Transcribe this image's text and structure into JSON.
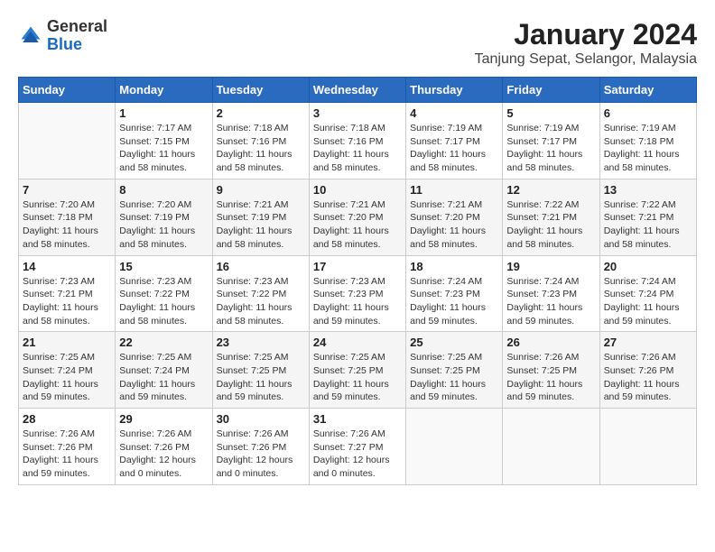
{
  "header": {
    "logo_line1": "General",
    "logo_line2": "Blue",
    "title": "January 2024",
    "subtitle": "Tanjung Sepat, Selangor, Malaysia"
  },
  "calendar": {
    "days_of_week": [
      "Sunday",
      "Monday",
      "Tuesday",
      "Wednesday",
      "Thursday",
      "Friday",
      "Saturday"
    ],
    "weeks": [
      [
        {
          "day": "",
          "sunrise": "",
          "sunset": "",
          "daylight": ""
        },
        {
          "day": "1",
          "sunrise": "Sunrise: 7:17 AM",
          "sunset": "Sunset: 7:15 PM",
          "daylight": "Daylight: 11 hours and 58 minutes."
        },
        {
          "day": "2",
          "sunrise": "Sunrise: 7:18 AM",
          "sunset": "Sunset: 7:16 PM",
          "daylight": "Daylight: 11 hours and 58 minutes."
        },
        {
          "day": "3",
          "sunrise": "Sunrise: 7:18 AM",
          "sunset": "Sunset: 7:16 PM",
          "daylight": "Daylight: 11 hours and 58 minutes."
        },
        {
          "day": "4",
          "sunrise": "Sunrise: 7:19 AM",
          "sunset": "Sunset: 7:17 PM",
          "daylight": "Daylight: 11 hours and 58 minutes."
        },
        {
          "day": "5",
          "sunrise": "Sunrise: 7:19 AM",
          "sunset": "Sunset: 7:17 PM",
          "daylight": "Daylight: 11 hours and 58 minutes."
        },
        {
          "day": "6",
          "sunrise": "Sunrise: 7:19 AM",
          "sunset": "Sunset: 7:18 PM",
          "daylight": "Daylight: 11 hours and 58 minutes."
        }
      ],
      [
        {
          "day": "7",
          "sunrise": "Sunrise: 7:20 AM",
          "sunset": "Sunset: 7:18 PM",
          "daylight": "Daylight: 11 hours and 58 minutes."
        },
        {
          "day": "8",
          "sunrise": "Sunrise: 7:20 AM",
          "sunset": "Sunset: 7:19 PM",
          "daylight": "Daylight: 11 hours and 58 minutes."
        },
        {
          "day": "9",
          "sunrise": "Sunrise: 7:21 AM",
          "sunset": "Sunset: 7:19 PM",
          "daylight": "Daylight: 11 hours and 58 minutes."
        },
        {
          "day": "10",
          "sunrise": "Sunrise: 7:21 AM",
          "sunset": "Sunset: 7:20 PM",
          "daylight": "Daylight: 11 hours and 58 minutes."
        },
        {
          "day": "11",
          "sunrise": "Sunrise: 7:21 AM",
          "sunset": "Sunset: 7:20 PM",
          "daylight": "Daylight: 11 hours and 58 minutes."
        },
        {
          "day": "12",
          "sunrise": "Sunrise: 7:22 AM",
          "sunset": "Sunset: 7:21 PM",
          "daylight": "Daylight: 11 hours and 58 minutes."
        },
        {
          "day": "13",
          "sunrise": "Sunrise: 7:22 AM",
          "sunset": "Sunset: 7:21 PM",
          "daylight": "Daylight: 11 hours and 58 minutes."
        }
      ],
      [
        {
          "day": "14",
          "sunrise": "Sunrise: 7:23 AM",
          "sunset": "Sunset: 7:21 PM",
          "daylight": "Daylight: 11 hours and 58 minutes."
        },
        {
          "day": "15",
          "sunrise": "Sunrise: 7:23 AM",
          "sunset": "Sunset: 7:22 PM",
          "daylight": "Daylight: 11 hours and 58 minutes."
        },
        {
          "day": "16",
          "sunrise": "Sunrise: 7:23 AM",
          "sunset": "Sunset: 7:22 PM",
          "daylight": "Daylight: 11 hours and 58 minutes."
        },
        {
          "day": "17",
          "sunrise": "Sunrise: 7:23 AM",
          "sunset": "Sunset: 7:23 PM",
          "daylight": "Daylight: 11 hours and 59 minutes."
        },
        {
          "day": "18",
          "sunrise": "Sunrise: 7:24 AM",
          "sunset": "Sunset: 7:23 PM",
          "daylight": "Daylight: 11 hours and 59 minutes."
        },
        {
          "day": "19",
          "sunrise": "Sunrise: 7:24 AM",
          "sunset": "Sunset: 7:23 PM",
          "daylight": "Daylight: 11 hours and 59 minutes."
        },
        {
          "day": "20",
          "sunrise": "Sunrise: 7:24 AM",
          "sunset": "Sunset: 7:24 PM",
          "daylight": "Daylight: 11 hours and 59 minutes."
        }
      ],
      [
        {
          "day": "21",
          "sunrise": "Sunrise: 7:25 AM",
          "sunset": "Sunset: 7:24 PM",
          "daylight": "Daylight: 11 hours and 59 minutes."
        },
        {
          "day": "22",
          "sunrise": "Sunrise: 7:25 AM",
          "sunset": "Sunset: 7:24 PM",
          "daylight": "Daylight: 11 hours and 59 minutes."
        },
        {
          "day": "23",
          "sunrise": "Sunrise: 7:25 AM",
          "sunset": "Sunset: 7:25 PM",
          "daylight": "Daylight: 11 hours and 59 minutes."
        },
        {
          "day": "24",
          "sunrise": "Sunrise: 7:25 AM",
          "sunset": "Sunset: 7:25 PM",
          "daylight": "Daylight: 11 hours and 59 minutes."
        },
        {
          "day": "25",
          "sunrise": "Sunrise: 7:25 AM",
          "sunset": "Sunset: 7:25 PM",
          "daylight": "Daylight: 11 hours and 59 minutes."
        },
        {
          "day": "26",
          "sunrise": "Sunrise: 7:26 AM",
          "sunset": "Sunset: 7:25 PM",
          "daylight": "Daylight: 11 hours and 59 minutes."
        },
        {
          "day": "27",
          "sunrise": "Sunrise: 7:26 AM",
          "sunset": "Sunset: 7:26 PM",
          "daylight": "Daylight: 11 hours and 59 minutes."
        }
      ],
      [
        {
          "day": "28",
          "sunrise": "Sunrise: 7:26 AM",
          "sunset": "Sunset: 7:26 PM",
          "daylight": "Daylight: 11 hours and 59 minutes."
        },
        {
          "day": "29",
          "sunrise": "Sunrise: 7:26 AM",
          "sunset": "Sunset: 7:26 PM",
          "daylight": "Daylight: 12 hours and 0 minutes."
        },
        {
          "day": "30",
          "sunrise": "Sunrise: 7:26 AM",
          "sunset": "Sunset: 7:26 PM",
          "daylight": "Daylight: 12 hours and 0 minutes."
        },
        {
          "day": "31",
          "sunrise": "Sunrise: 7:26 AM",
          "sunset": "Sunset: 7:27 PM",
          "daylight": "Daylight: 12 hours and 0 minutes."
        },
        {
          "day": "",
          "sunrise": "",
          "sunset": "",
          "daylight": ""
        },
        {
          "day": "",
          "sunrise": "",
          "sunset": "",
          "daylight": ""
        },
        {
          "day": "",
          "sunrise": "",
          "sunset": "",
          "daylight": ""
        }
      ]
    ]
  }
}
